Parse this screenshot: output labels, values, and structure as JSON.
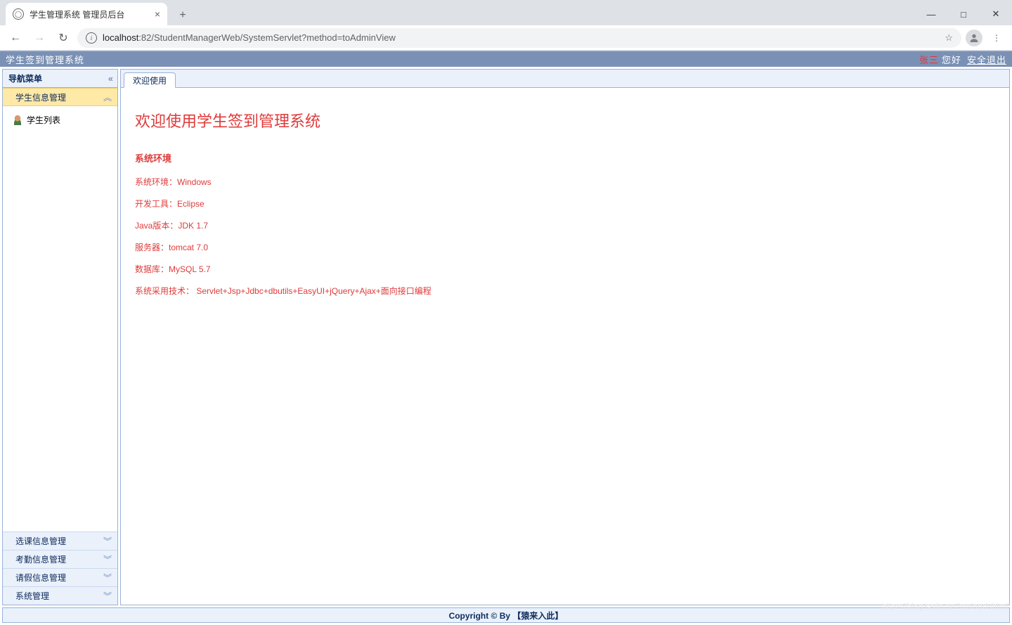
{
  "browser": {
    "tab_title": "学生管理系统 管理员后台",
    "url_host": "localhost",
    "url_port": ":82",
    "url_path": "/StudentManagerWeb/SystemServlet?method=toAdminView"
  },
  "header": {
    "app_title": "学生签到管理系统",
    "user_name": "张三",
    "greeting": "您好",
    "logout": "安全退出"
  },
  "sidebar": {
    "title": "导航菜单",
    "tree_item": "学生列表",
    "groups": [
      {
        "label": "学生信息管理",
        "expanded": true
      },
      {
        "label": "选课信息管理",
        "expanded": false
      },
      {
        "label": "考勤信息管理",
        "expanded": false
      },
      {
        "label": "请假信息管理",
        "expanded": false
      },
      {
        "label": "系统管理",
        "expanded": false
      }
    ]
  },
  "main": {
    "tab_label": "欢迎使用",
    "welcome_title": "欢迎使用学生签到管理系统",
    "env_heading": "系统环境",
    "lines": [
      "系统环境：Windows",
      "开发工具：Eclipse",
      "Java版本：JDK 1.7",
      "服务器：tomcat 7.0",
      "数据库：MySQL 5.7",
      "系统采用技术： Servlet+Jsp+Jdbc+dbutils+EasyUI+jQuery+Ajax+面向接口编程"
    ]
  },
  "footer": "Copyright © By 【猿来入此】",
  "watermark": "https://blog.csdn.net/malaoduhtml"
}
